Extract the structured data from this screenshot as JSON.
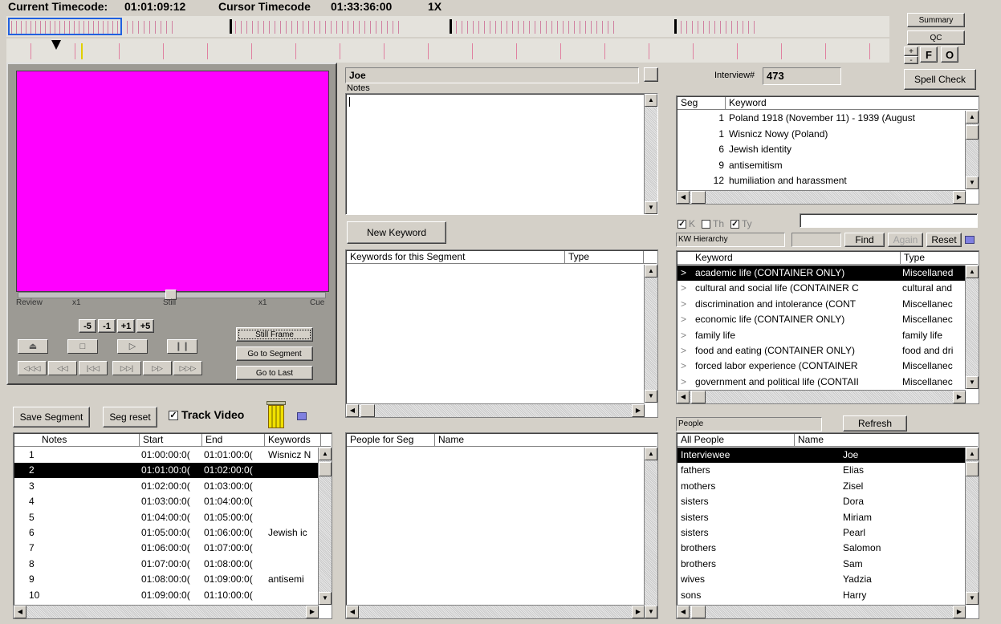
{
  "timeline": {
    "current_label": "Current Timecode:",
    "current_value": "01:01:09:12",
    "cursor_label": "Cursor Timecode",
    "cursor_value": "01:33:36:00",
    "speed": "1X"
  },
  "top_buttons": {
    "summary": "Summary",
    "qc": "QC",
    "plus": "+",
    "minus": "-",
    "f": "F",
    "o": "O"
  },
  "video": {
    "screen_color": "#ff00ff",
    "slider_labels": [
      "Review",
      "x1",
      "Still",
      "x1",
      "Cue"
    ],
    "step_buttons": [
      "-5",
      "-1",
      "+1",
      "+5"
    ],
    "still_frame": "Still Frame",
    "go_to_segment": "Go to Segment",
    "go_to_last": "Go to Last"
  },
  "segment_controls": {
    "save_segment": "Save Segment",
    "seg_reset": "Seg reset",
    "track_video_label": "Track Video",
    "track_video_checked": true
  },
  "segments_table": {
    "headers": [
      "Notes",
      "Start",
      "End",
      "Keywords"
    ],
    "rows": [
      {
        "n": "1",
        "start": "01:00:00:0(",
        "end": "01:01:00:0(",
        "kw": "Wisnicz N"
      },
      {
        "n": "2",
        "start": "01:01:00:0(",
        "end": "01:02:00:0(",
        "kw": ""
      },
      {
        "n": "3",
        "start": "01:02:00:0(",
        "end": "01:03:00:0(",
        "kw": ""
      },
      {
        "n": "4",
        "start": "01:03:00:0(",
        "end": "01:04:00:0(",
        "kw": ""
      },
      {
        "n": "5",
        "start": "01:04:00:0(",
        "end": "01:05:00:0(",
        "kw": ""
      },
      {
        "n": "6",
        "start": "01:05:00:0(",
        "end": "01:06:00:0(",
        "kw": "Jewish ic"
      },
      {
        "n": "7",
        "start": "01:06:00:0(",
        "end": "01:07:00:0(",
        "kw": ""
      },
      {
        "n": "8",
        "start": "01:07:00:0(",
        "end": "01:08:00:0(",
        "kw": ""
      },
      {
        "n": "9",
        "start": "01:08:00:0(",
        "end": "01:09:00:0(",
        "kw": "antisemi"
      },
      {
        "n": "10",
        "start": "01:09:00:0(",
        "end": "01:10:00:0(",
        "kw": ""
      }
    ]
  },
  "notes_panel": {
    "name": "Joe",
    "notes_label": "Notes",
    "new_keyword": "New Keyword"
  },
  "keywords_segment": {
    "headers": [
      "Keywords for this Segment",
      "Type"
    ]
  },
  "people_segment": {
    "headers": [
      "People for Seg",
      "Name"
    ]
  },
  "interview": {
    "label": "Interview#",
    "value": "473",
    "spell_check": "Spell Check"
  },
  "keyword_list": {
    "headers": [
      "Seg",
      "Keyword"
    ],
    "rows": [
      {
        "seg": "1",
        "kw": "Poland 1918 (November 11) - 1939 (August"
      },
      {
        "seg": "1",
        "kw": "Wisnicz Nowy (Poland)"
      },
      {
        "seg": "6",
        "kw": "Jewish identity"
      },
      {
        "seg": "9",
        "kw": "antisemitism"
      },
      {
        "seg": "12",
        "kw": "humiliation and harassment"
      }
    ]
  },
  "kw_filters": {
    "k": "K",
    "th": "Th",
    "ty": "Ty",
    "hierarchy_label": "KW Hierarchy",
    "find": "Find",
    "again": "Again",
    "reset": "Reset"
  },
  "hierarchy_list": {
    "headers": [
      "Keyword",
      "Type"
    ],
    "rows": [
      {
        "kw": "academic life (CONTAINER ONLY)",
        "type": "Miscellaned"
      },
      {
        "kw": "cultural and social life (CONTAINER C",
        "type": "cultural and"
      },
      {
        "kw": "discrimination and intolerance (CONT",
        "type": "Miscellanec"
      },
      {
        "kw": "economic life (CONTAINER ONLY)",
        "type": "Miscellanec"
      },
      {
        "kw": "family life",
        "type": "family life"
      },
      {
        "kw": "food and eating (CONTAINER ONLY)",
        "type": "food and dri"
      },
      {
        "kw": "forced labor experience (CONTAINER",
        "type": "Miscellanec"
      },
      {
        "kw": "government and political life (CONTAII",
        "type": "Miscellanec"
      }
    ]
  },
  "people": {
    "label": "People",
    "refresh": "Refresh",
    "headers": [
      "All People",
      "Name"
    ],
    "rows": [
      {
        "rel": "Interviewee",
        "name": "Joe"
      },
      {
        "rel": "fathers",
        "name": "Elias"
      },
      {
        "rel": "mothers",
        "name": "Zisel"
      },
      {
        "rel": "sisters",
        "name": "Dora"
      },
      {
        "rel": "sisters",
        "name": "Miriam"
      },
      {
        "rel": "sisters",
        "name": "Pearl"
      },
      {
        "rel": "brothers",
        "name": "Salomon"
      },
      {
        "rel": "brothers",
        "name": "Sam"
      },
      {
        "rel": "wives",
        "name": "Yadzia"
      },
      {
        "rel": "sons",
        "name": "Harry"
      }
    ]
  }
}
